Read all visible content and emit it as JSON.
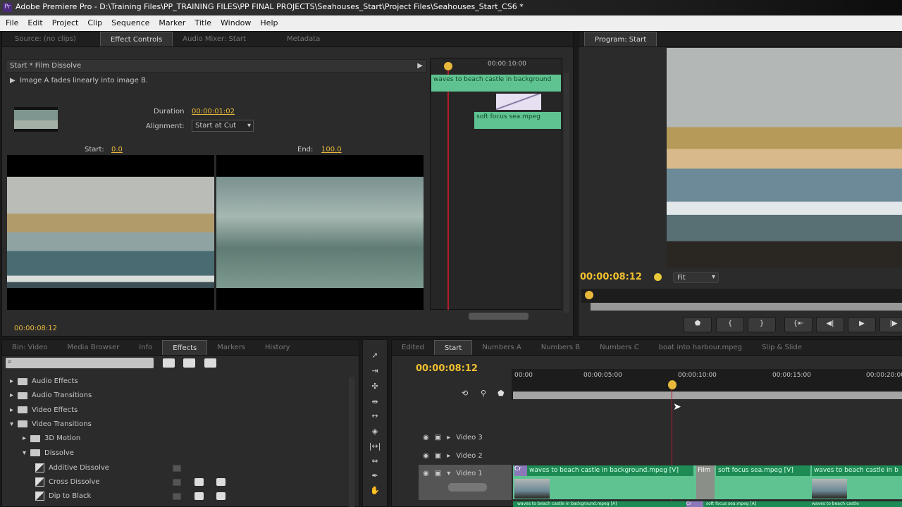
{
  "app": {
    "title": "Adobe Premiere Pro - D:\\Training Files\\PP_TRAINING FILES\\PP FINAL PROJECTS\\Seahouses_Start\\Project Files\\Seahouses_Start_CS6 *",
    "logo": "Pr"
  },
  "menu": [
    "File",
    "Edit",
    "Project",
    "Clip",
    "Sequence",
    "Marker",
    "Title",
    "Window",
    "Help"
  ],
  "source_tabs": [
    "Source: (no clips)",
    "Effect Controls",
    "Audio Mixer: Start",
    "Metadata"
  ],
  "effect_controls": {
    "header": "Start * Film Dissolve",
    "description": "Image A fades linearly into image B.",
    "duration_label": "Duration",
    "duration": "00:00:01:02",
    "alignment_label": "Alignment:",
    "alignment": "Start at Cut",
    "start_label": "Start:",
    "start": "0.0",
    "end_label": "End:",
    "end": "100.0",
    "timecode": "00:00:08:12",
    "mini_ruler": "00:00:10:00",
    "clip_a": "waves to beach castle in background",
    "clip_b": "soft focus sea.mpeg"
  },
  "program": {
    "tab": "Program: Start",
    "timecode": "00:00:08:12",
    "fit": "Fit"
  },
  "effects_panel": {
    "tabs": [
      "Bin: Video",
      "Media Browser",
      "Info",
      "Effects",
      "Markers",
      "History"
    ],
    "tree": [
      {
        "label": "Audio Effects",
        "level": 0,
        "open": false
      },
      {
        "label": "Audio Transitions",
        "level": 0,
        "open": false
      },
      {
        "label": "Video Effects",
        "level": 0,
        "open": false
      },
      {
        "label": "Video Transitions",
        "level": 0,
        "open": true
      },
      {
        "label": "3D Motion",
        "level": 1,
        "open": false
      },
      {
        "label": "Dissolve",
        "level": 1,
        "open": true
      },
      {
        "label": "Additive Dissolve",
        "level": 2,
        "fx": true
      },
      {
        "label": "Cross Dissolve",
        "level": 2,
        "fx": true
      },
      {
        "label": "Dip to Black",
        "level": 2,
        "fx": true
      }
    ]
  },
  "timeline": {
    "tabs": [
      "Edited",
      "Start",
      "Numbers A",
      "Numbers B",
      "Numbers C",
      "boat into harbour.mpeg",
      "Slip & Slide"
    ],
    "active_tab": "Start",
    "timecode": "00:00:08:12",
    "ruler": [
      "00:00",
      "00:00:05:00",
      "00:00:10:00",
      "00:00:15:00",
      "00:00:20:00"
    ],
    "tracks": [
      "Video 3",
      "Video 2",
      "Video 1"
    ],
    "clips": [
      "waves to beach castle in background.mpeg [V]",
      "soft focus sea.mpeg [V]",
      "waves to beach castle in b"
    ],
    "transition": "Film",
    "transition_start": "Cr",
    "audio_clips": [
      "waves to beach castle in background.mpeg [A]",
      "soft focus sea.mpeg [A]",
      "waves to beach castle"
    ],
    "audio_transition": "Cr"
  }
}
